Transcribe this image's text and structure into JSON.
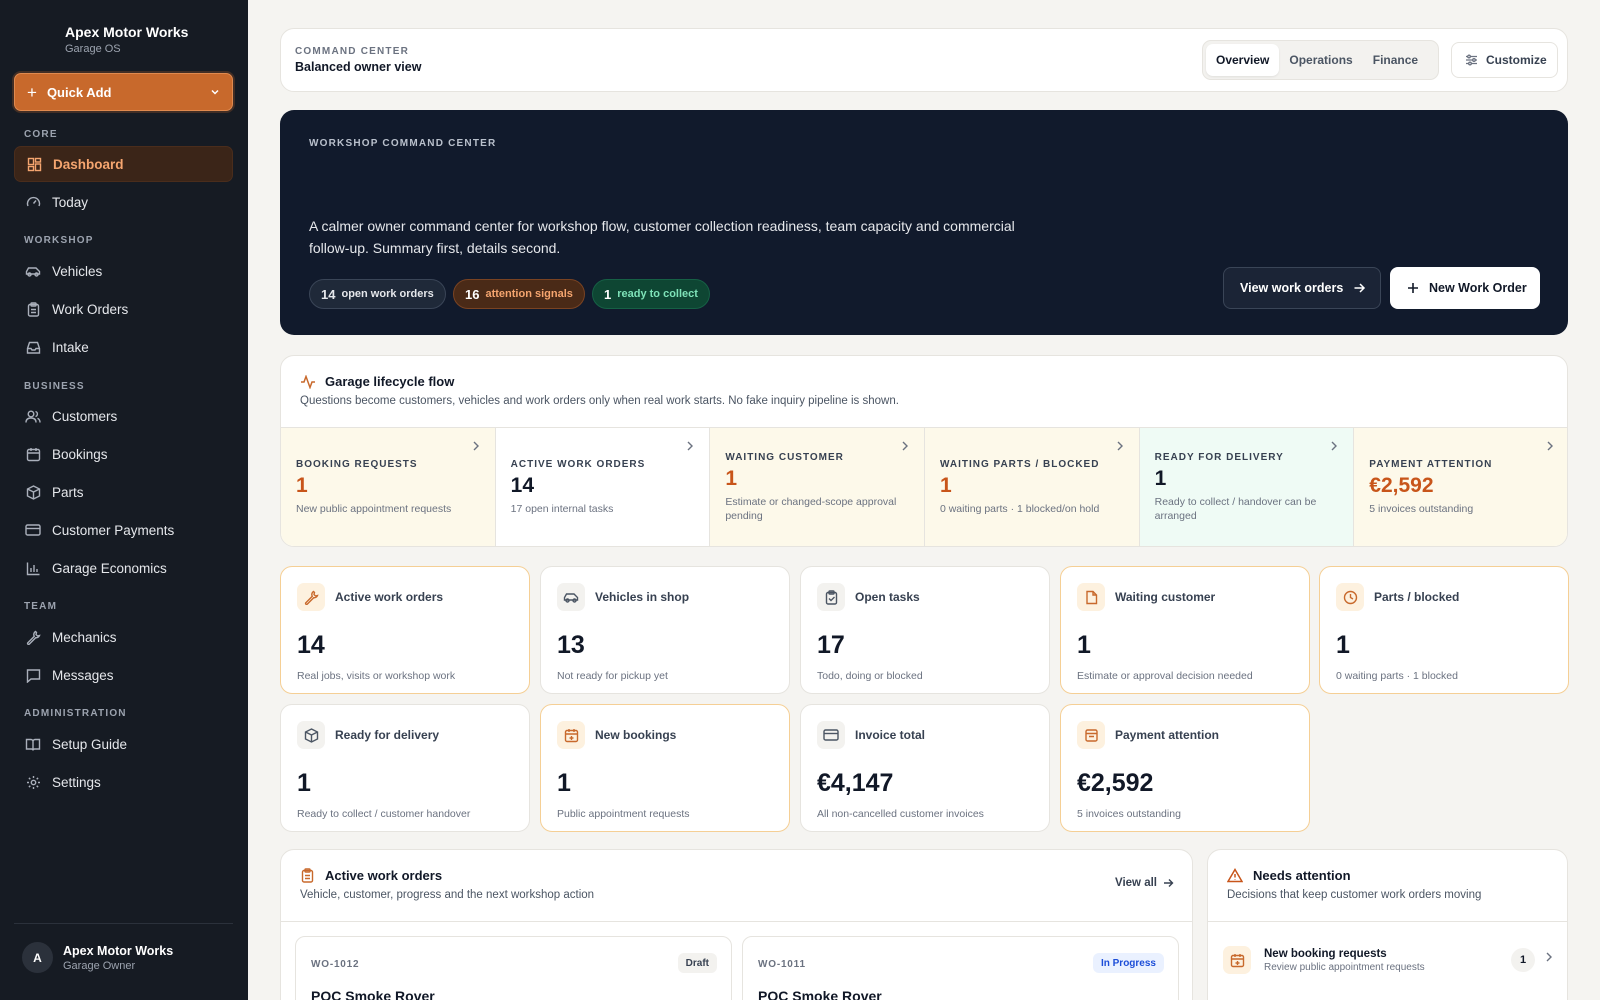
{
  "sidebar": {
    "brand_name": "Apex Motor Works",
    "brand_sub": "Garage OS",
    "quick_add": "Quick Add",
    "sections": {
      "core": "CORE",
      "workshop": "WORKSHOP",
      "business": "BUSINESS",
      "team": "TEAM",
      "administration": "ADMINISTRATION"
    },
    "items": {
      "dashboard": "Dashboard",
      "today": "Today",
      "vehicles": "Vehicles",
      "work_orders": "Work Orders",
      "intake": "Intake",
      "customers": "Customers",
      "bookings": "Bookings",
      "parts": "Parts",
      "customer_payments": "Customer Payments",
      "garage_economics": "Garage Economics",
      "mechanics": "Mechanics",
      "messages": "Messages",
      "setup_guide": "Setup Guide",
      "settings": "Settings"
    },
    "user": {
      "initial": "A",
      "name": "Apex Motor Works",
      "role": "Garage Owner"
    }
  },
  "topbar": {
    "eyebrow": "COMMAND CENTER",
    "title": "Balanced owner view",
    "tabs": {
      "overview": "Overview",
      "operations": "Operations",
      "finance": "Finance"
    },
    "customize": "Customize"
  },
  "hero": {
    "eyebrow": "WORKSHOP COMMAND CENTER",
    "description": "A calmer owner command center for workshop flow, customer collection readiness, team capacity and commercial follow-up. Summary first, details second.",
    "chips": {
      "open": {
        "count": "14",
        "label": "open work orders"
      },
      "attention": {
        "count": "16",
        "label": "attention signals"
      },
      "ready": {
        "count": "1",
        "label": "ready to collect"
      }
    },
    "view_work_orders": "View work orders",
    "new_work_order": "New Work Order"
  },
  "lifecycle": {
    "title": "Garage lifecycle flow",
    "subtitle": "Questions become customers, vehicles and work orders only when real work starts. No fake inquiry pipeline is shown.",
    "stages": {
      "booking": {
        "label": "BOOKING REQUESTS",
        "value": "1",
        "desc": "New public appointment requests"
      },
      "active": {
        "label": "ACTIVE WORK ORDERS",
        "value": "14",
        "desc": "17 open internal tasks"
      },
      "waiting_customer": {
        "label": "WAITING CUSTOMER",
        "value": "1",
        "desc": "Estimate or changed-scope approval pending"
      },
      "waiting_parts": {
        "label": "WAITING PARTS / BLOCKED",
        "value": "1",
        "desc": "0 waiting parts · 1 blocked/on hold"
      },
      "ready": {
        "label": "READY FOR DELIVERY",
        "value": "1",
        "desc": "Ready to collect / handover can be arranged"
      },
      "payment": {
        "label": "PAYMENT ATTENTION",
        "value": "€2,592",
        "desc": "5 invoices outstanding"
      }
    }
  },
  "kpis": {
    "active_work_orders": {
      "label": "Active work orders",
      "value": "14",
      "desc": "Real jobs, visits or workshop work"
    },
    "vehicles_in_shop": {
      "label": "Vehicles in shop",
      "value": "13",
      "desc": "Not ready for pickup yet"
    },
    "open_tasks": {
      "label": "Open tasks",
      "value": "17",
      "desc": "Todo, doing or blocked"
    },
    "waiting_customer": {
      "label": "Waiting customer",
      "value": "1",
      "desc": "Estimate or approval decision needed"
    },
    "parts_blocked": {
      "label": "Parts / blocked",
      "value": "1",
      "desc": "0 waiting parts · 1 blocked"
    },
    "ready_for_delivery": {
      "label": "Ready for delivery",
      "value": "1",
      "desc": "Ready to collect / customer handover"
    },
    "new_bookings": {
      "label": "New bookings",
      "value": "1",
      "desc": "Public appointment requests"
    },
    "invoice_total": {
      "label": "Invoice total",
      "value": "€4,147",
      "desc": "All non-cancelled customer invoices"
    },
    "payment_attention": {
      "label": "Payment attention",
      "value": "€2,592",
      "desc": "5 invoices outstanding"
    }
  },
  "work_orders": {
    "title": "Active work orders",
    "subtitle": "Vehicle, customer, progress and the next workshop action",
    "view_all": "View all",
    "items": [
      {
        "id": "WO-1012",
        "status": "Draft",
        "vehicle": "POC Smoke Rover"
      },
      {
        "id": "WO-1011",
        "status": "In Progress",
        "vehicle": "POC Smoke Rover"
      }
    ]
  },
  "attention": {
    "title": "Needs attention",
    "subtitle": "Decisions that keep customer work orders moving",
    "items": [
      {
        "title": "New booking requests",
        "sub": "Review public appointment requests",
        "count": "1"
      }
    ]
  },
  "colors": {
    "accent": "#c8692c",
    "sidebar": "#161b23",
    "hero": "#111a2c"
  }
}
